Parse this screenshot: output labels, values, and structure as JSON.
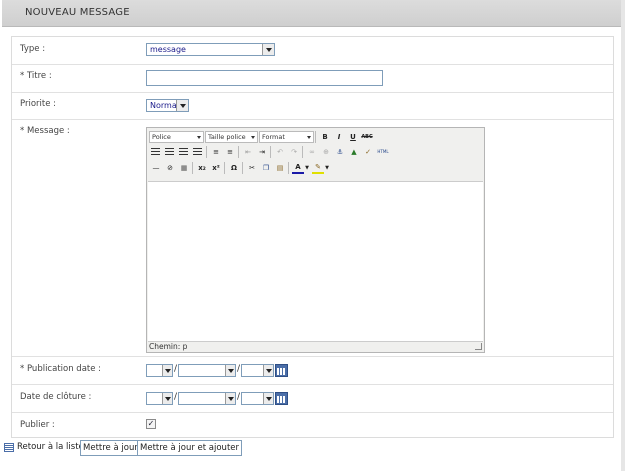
{
  "header": {
    "title": "NOUVEAU MESSAGE"
  },
  "form": {
    "type": {
      "label": "Type :",
      "value": "message"
    },
    "titre": {
      "label": "* Titre :",
      "value": ""
    },
    "priorite": {
      "label": "Priorite :",
      "value": "Normal"
    },
    "message": {
      "label": "* Message :",
      "toolbar": {
        "font_label": "Police",
        "size_label": "Taille police",
        "format_label": "Format",
        "bold": "B",
        "italic": "I",
        "underline": "U",
        "strike": "ABC",
        "html": "HTML",
        "subscript": "x₂",
        "superscript": "x²",
        "omega": "Ω",
        "fore_color": "A",
        "icons_row2": [
          "align-left-icon",
          "align-center-icon",
          "align-right-icon",
          "align-justify-icon",
          "bullet-list-icon",
          "numbered-list-icon",
          "outdent-icon",
          "indent-icon",
          "undo-icon",
          "redo-icon",
          "link-icon",
          "unlink-icon",
          "anchor-icon",
          "image-icon",
          "cleanup-icon",
          "html-icon"
        ],
        "icons_row3": [
          "horizontal-rule-icon",
          "remove-format-icon",
          "visual-aid-icon",
          "subscript-icon",
          "superscript-icon",
          "special-char-icon",
          "cut-icon",
          "copy-icon",
          "paste-icon",
          "text-color-icon",
          "background-color-icon"
        ]
      },
      "path_label": "Chemin:",
      "path_value": "p"
    },
    "publication_date": {
      "label": "* Publication date :",
      "separator": "/"
    },
    "date_cloture": {
      "label": "Date de clôture :",
      "separator": "/"
    },
    "publier": {
      "label": "Publier :",
      "checked": true,
      "check_mark": "✓"
    }
  },
  "footer": {
    "back_label": "Retour à la liste",
    "update_label": "Mettre à jour",
    "update_add_label": "Mettre à jour et ajouter"
  },
  "colors": {
    "header_bg": "#d3d3d3",
    "border": "#7f9db9",
    "link_text": "#222222"
  }
}
